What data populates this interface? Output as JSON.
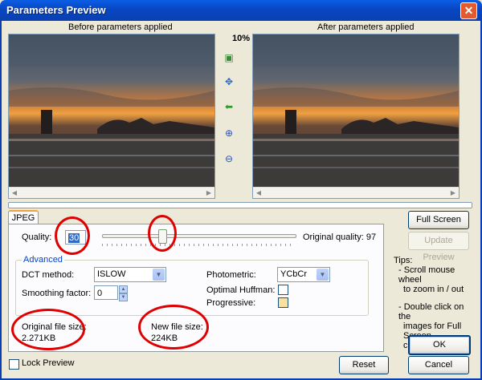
{
  "window": {
    "title": "Parameters Preview",
    "close_glyph": "✕"
  },
  "preview": {
    "before_label": "Before parameters applied",
    "after_label": "After parameters applied",
    "zoom": "10%",
    "tools": [
      "image-icon",
      "move-icon",
      "back-arrow-icon",
      "zoom-in-icon",
      "zoom-out-icon"
    ]
  },
  "tab": {
    "label": "JPEG"
  },
  "quality": {
    "label": "Quality:",
    "value": "30",
    "original_label": "Original quality: 97",
    "slider_level_percent": 30
  },
  "advanced": {
    "label": "Advanced",
    "dct_label": "DCT method:",
    "dct_value": "ISLOW",
    "smoothing_label": "Smoothing factor:",
    "smoothing_value": "0",
    "photometric_label": "Photometric:",
    "photometric_value": "YCbCr",
    "optimal_huffman_label": "Optimal Huffman:",
    "progressive_label": "Progressive:"
  },
  "sizes": {
    "original_label": "Original file size:",
    "original_value": "2.271KB",
    "new_label": "New file size:",
    "new_value": "224KB"
  },
  "buttons": {
    "full_screen": "Full Screen",
    "update_preview": "Update Preview",
    "ok": "OK",
    "cancel": "Cancel",
    "reset": "Reset"
  },
  "tips": {
    "title": "Tips:",
    "line1": "- Scroll mouse wheel",
    "line2": "to zoom in / out",
    "line3": "- Double click on the",
    "line4": "images for Full Screen",
    "line5": "comparison"
  },
  "lock_preview": {
    "label": "Lock Preview"
  },
  "colors": {
    "titlebar": "#0848c4",
    "annotation": "#e00000"
  }
}
